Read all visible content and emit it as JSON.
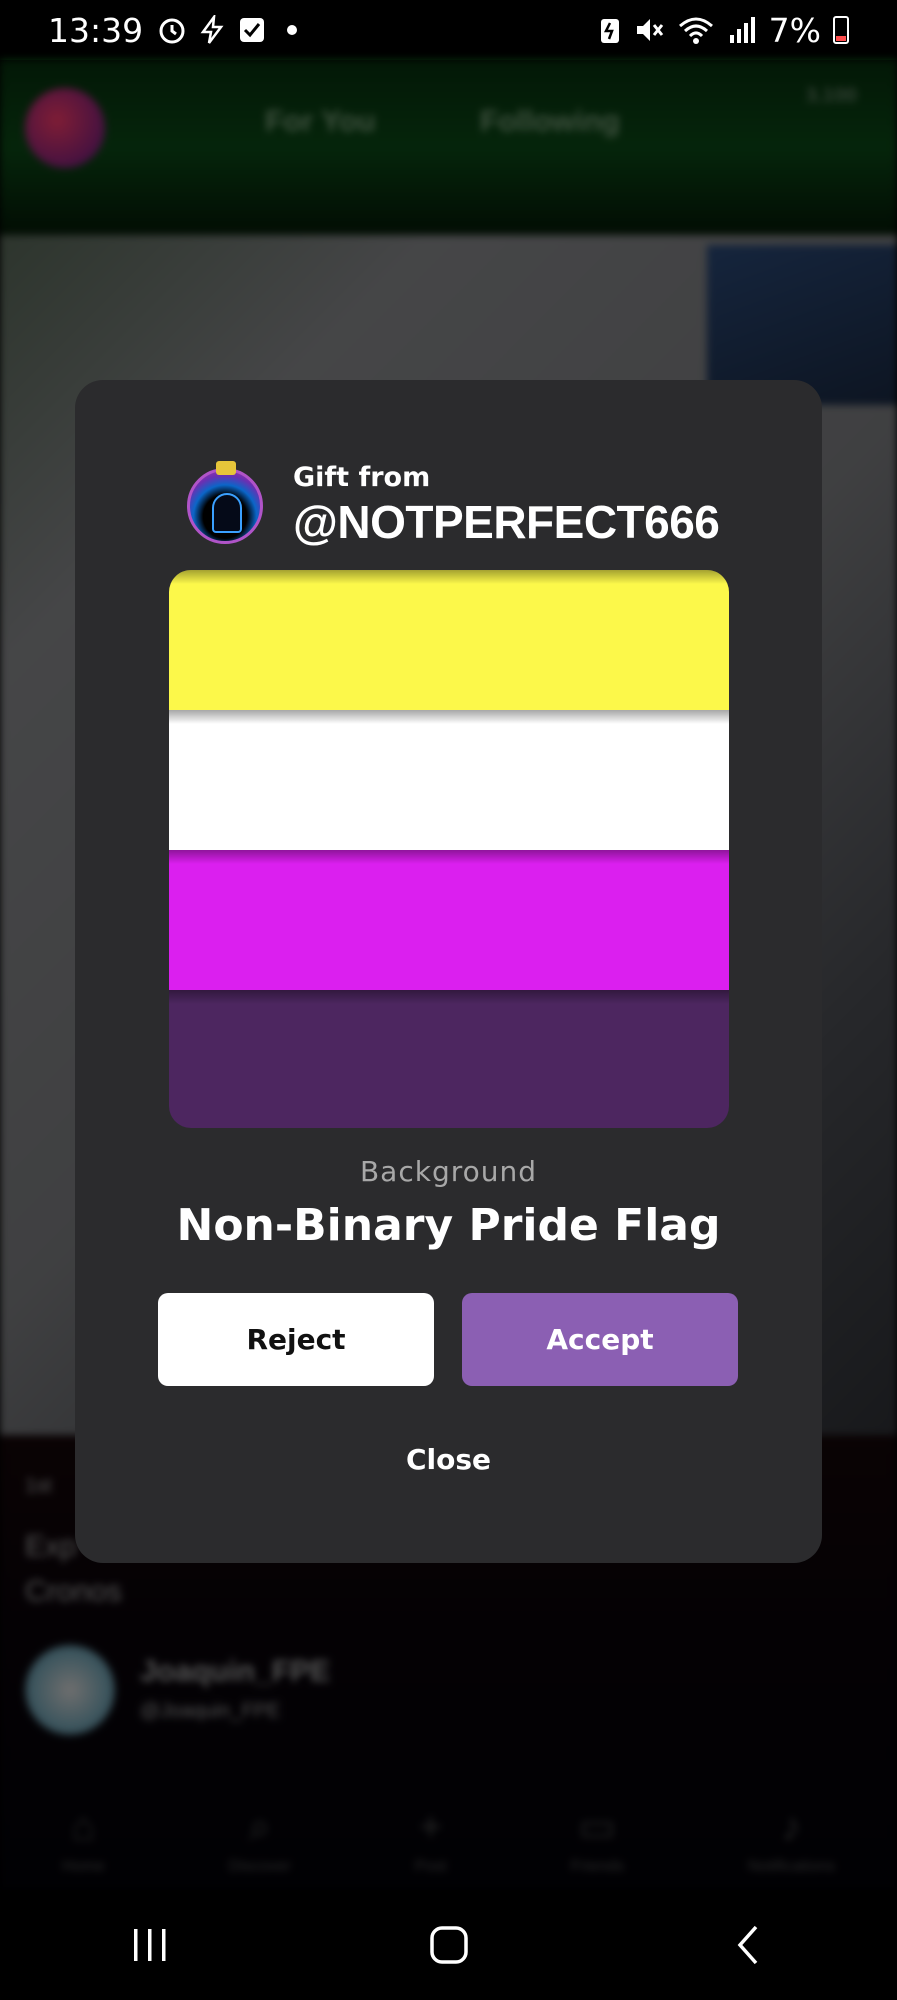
{
  "status_bar": {
    "time": "13:39",
    "battery": "7%",
    "left_icons": [
      "alarm-icon",
      "flash-icon",
      "check-icon",
      "dot-icon"
    ],
    "right_icons": [
      "battery-saver-icon",
      "mute-icon",
      "wifi-icon",
      "signal-icon"
    ]
  },
  "background_app": {
    "tabs": [
      "For You",
      "Following"
    ],
    "coins": "3,100",
    "caption_lines": [
      "Exp",
      "Cronos"
    ],
    "small_line": "1st",
    "user_name": "Joaquin_FPE",
    "user_handle": "@Joaquin_FPE",
    "nav_items": [
      {
        "label": "Home",
        "icon": "home-icon"
      },
      {
        "label": "Discover",
        "icon": "search-icon"
      },
      {
        "label": "Post",
        "icon": "plus-icon"
      },
      {
        "label": "Friends",
        "icon": "chat-icon"
      },
      {
        "label": "Notifications",
        "icon": "bell-icon"
      }
    ]
  },
  "gift_modal": {
    "from_label": "Gift from",
    "sender": "@NOTPERFECT666",
    "item_category": "Background",
    "item_name": "Non-Binary Pride Flag",
    "flag_colors": [
      "#fcf84a",
      "#ffffff",
      "#db1fef",
      "#4d2660"
    ],
    "reject_label": "Reject",
    "accept_label": "Accept",
    "close_label": "Close",
    "accent_color": "#8b5fb3"
  },
  "system_nav": {
    "buttons": [
      "recents-icon",
      "home-icon",
      "back-icon"
    ]
  }
}
